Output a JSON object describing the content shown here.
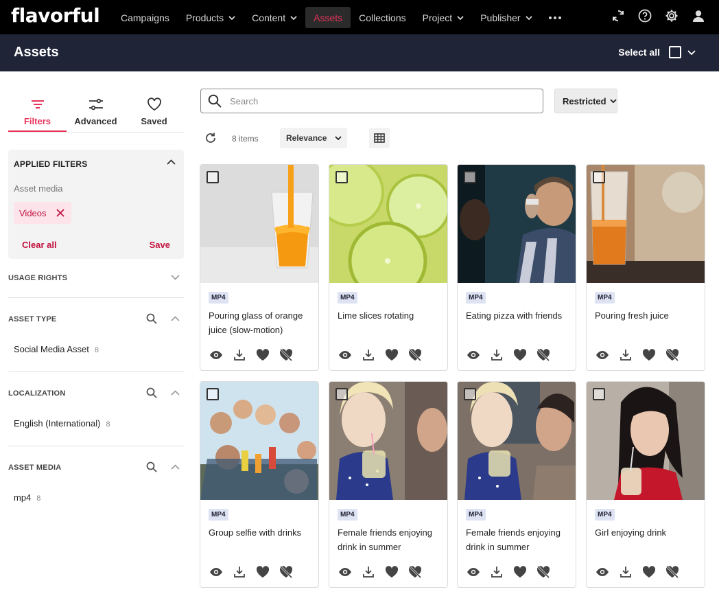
{
  "topbar": {
    "logo": "flavorful",
    "nav": [
      {
        "label": "Campaigns",
        "dropdown": false,
        "active": false
      },
      {
        "label": "Products",
        "dropdown": true,
        "active": false
      },
      {
        "label": "Content",
        "dropdown": true,
        "active": false
      },
      {
        "label": "Assets",
        "dropdown": false,
        "active": true
      },
      {
        "label": "Collections",
        "dropdown": false,
        "active": false
      },
      {
        "label": "Project",
        "dropdown": true,
        "active": false
      },
      {
        "label": "Publisher",
        "dropdown": true,
        "active": false
      }
    ],
    "more_icon": "more-horizontal-icon",
    "icons": [
      "sync-icon",
      "help-icon",
      "gear-icon",
      "user-icon"
    ]
  },
  "header": {
    "title": "Assets",
    "select_all": "Select all"
  },
  "sidebar": {
    "tabs": [
      {
        "label": "Filters",
        "icon": "filter-icon",
        "active": true
      },
      {
        "label": "Advanced",
        "icon": "sliders-icon",
        "active": false
      },
      {
        "label": "Saved",
        "icon": "heart-icon",
        "active": false
      }
    ],
    "applied": {
      "title": "APPLIED FILTERS",
      "facet_label": "Asset media",
      "chip": "Videos",
      "clear_all": "Clear all",
      "save": "Save"
    },
    "sections": [
      {
        "title": "USAGE RIGHTS",
        "searchable": false,
        "expanded": false,
        "values": []
      },
      {
        "title": "ASSET TYPE",
        "searchable": true,
        "expanded": true,
        "values": [
          {
            "label": "Social Media Asset",
            "count": "8"
          }
        ]
      },
      {
        "title": "LOCALIZATION",
        "searchable": true,
        "expanded": true,
        "values": [
          {
            "label": "English (International)",
            "count": "8"
          }
        ]
      },
      {
        "title": "ASSET MEDIA",
        "searchable": true,
        "expanded": true,
        "values": [
          {
            "label": "mp4",
            "count": "8"
          }
        ]
      }
    ]
  },
  "toolbar": {
    "search_placeholder": "Search",
    "restricted": "Restricted",
    "count": "8 items",
    "sort": "Relevance"
  },
  "assets": [
    {
      "title": "Pouring glass of orange juice (slow-motion)",
      "format": "MP4"
    },
    {
      "title": "Lime slices rotating",
      "format": "MP4"
    },
    {
      "title": "Eating pizza with friends",
      "format": "MP4"
    },
    {
      "title": "Pouring fresh juice",
      "format": "MP4"
    },
    {
      "title": "Group selfie with drinks",
      "format": "MP4"
    },
    {
      "title": "Female friends enjoying drink in summer",
      "format": "MP4"
    },
    {
      "title": "Female friends enjoying drink in summer",
      "format": "MP4"
    },
    {
      "title": "Girl enjoying drink",
      "format": "MP4"
    }
  ],
  "colors": {
    "accent": "#e8325a",
    "topbar": "#000000",
    "header": "#1f2437",
    "badge_bg": "#dde3f3"
  }
}
